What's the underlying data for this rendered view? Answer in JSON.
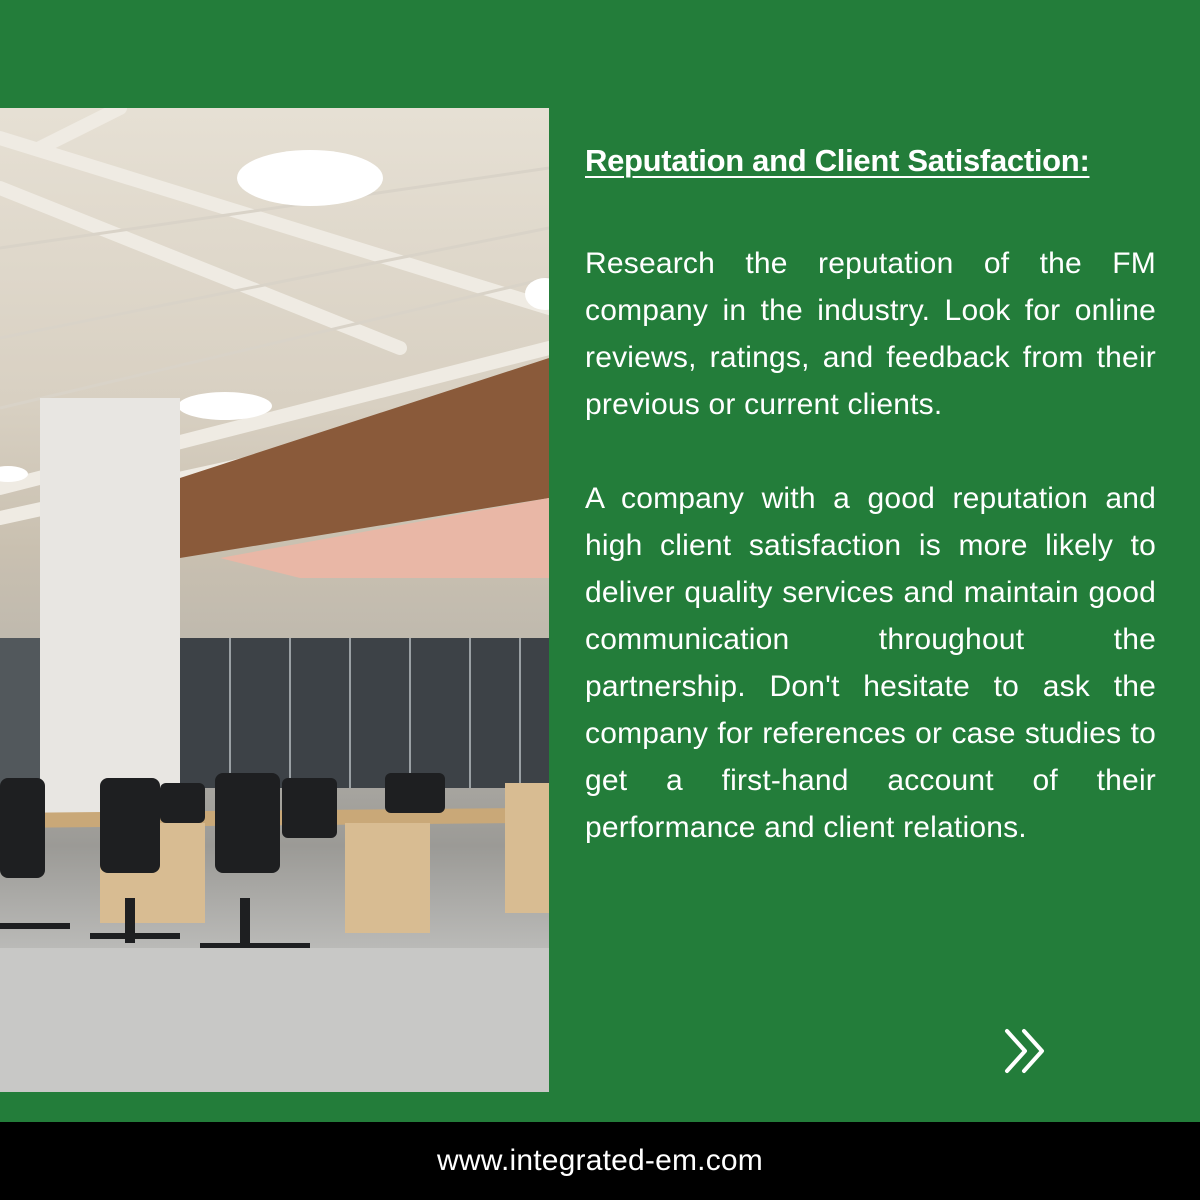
{
  "slide": {
    "heading": "Reputation and Client Satisfaction:",
    "paragraphs": [
      "Research the reputation of the FM company in the industry. Look for online reviews, ratings, and feedback from their previous or current clients.",
      "A company with a good reputation and high client satisfaction is more likely to deliver quality services and maintain good communication throughout the partnership. Don't hesitate to ask the company for references or case studies to get a first-hand account of their performance and client relations."
    ],
    "next_icon": "double-chevron-right-icon",
    "image_alt": "Modern open-plan office with ceiling lights, glass walls, wooden desks and black office chairs"
  },
  "footer": {
    "url": "www.integrated-em.com"
  },
  "colors": {
    "brand_green": "#237d3a",
    "footer_black": "#000000",
    "text": "#ffffff"
  }
}
